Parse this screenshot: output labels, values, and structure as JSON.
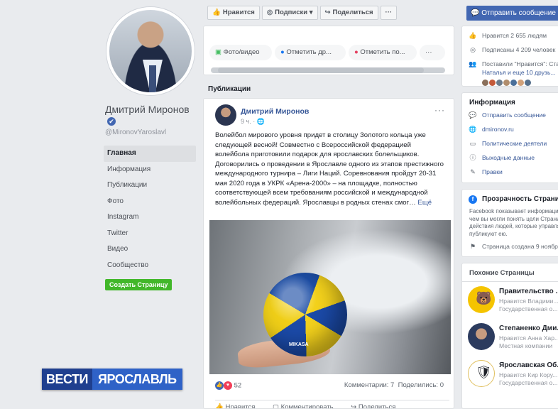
{
  "profile": {
    "name": "Дмитрий Миронов",
    "handle": "@MironovYaroslavl",
    "verified_icon": "✔"
  },
  "nav": {
    "items": [
      "Главная",
      "Информация",
      "Публикации",
      "Фото",
      "Instagram",
      "Twitter",
      "Видео",
      "Сообщество"
    ],
    "create_page": "Создать Страницу"
  },
  "actions": {
    "like": "Нравится",
    "subscribe": "Подписки",
    "share": "Поделиться",
    "more": "···",
    "send_message": "Отправить сообщение"
  },
  "composer": {
    "photo_video": "Фото/видео",
    "tag_friends": "Отметить др...",
    "check_in": "Отметить по...",
    "more": "···"
  },
  "publications": {
    "heading": "Публикации"
  },
  "post": {
    "author": "Дмитрий Миронов",
    "time": "9 ч.",
    "text": "Волейбол мирового уровня придет в столицу Золотого кольца уже следующей весной! Совместно с Всероссийской федерацией волейбола приготовили подарок для ярославских болельщиков. Договорились о проведении в Ярославле одного из этапов престижного международного турнира – Лиги Наций. Соревнования пройдут 20-31 мая 2020 года в УКРК «Арена-2000» – на площадке, полностью соответствующей всем требованиям российской и международной волейбольных федераций. Ярославцы в родных стенах смог…",
    "more": "Ещё",
    "reaction_count": "52",
    "comments": "Комментарии: 7",
    "shares": "Поделились: 0",
    "actions": [
      "Нравится",
      "Комментировать",
      "Поделиться"
    ],
    "photo_ball_brand": "MIKASA"
  },
  "stats": {
    "likes": "Нравится 2 655 людям",
    "follows": "Подписаны 4 209 человек",
    "friends_liked": "Поставили \"Нравится\": Ста...",
    "friends_liked_2": "Наталья и еще 10 друзь..."
  },
  "info": {
    "title": "Информация",
    "rows": [
      "Отправить сообщение",
      "dmironov.ru",
      "Политические деятели",
      "Выходные данные",
      "Правки"
    ]
  },
  "transparency": {
    "title": "Прозрачность Страни...",
    "text_1": "Facebook показывает информацию,",
    "text_2": "чем вы могли понять цели Страницы.",
    "text_3": "действия людей, которые управляют",
    "text_4": "публикуют ею.",
    "created": "Страница создана 9 ноября..."
  },
  "similar": {
    "title": "Похожие Страницы",
    "pages": [
      {
        "name": "Правительство ...",
        "sub_1": "Нравится Владими...",
        "sub_2": "Государственная о..."
      },
      {
        "name": "Степаненко Дми...",
        "sub_1": "Нравится Анна Хар...",
        "sub_2": "Местная компании"
      },
      {
        "name": "Ярославская Об...",
        "sub_1": "Нравится Кир Кору...",
        "sub_2": "Государственная о..."
      }
    ]
  },
  "tv_logo": {
    "part_a": "ВЕСТИ",
    "part_b": "ЯРОСЛАВЛЬ"
  },
  "colors": {
    "brand_blue": "#4267b2",
    "link_blue": "#385898",
    "create_green": "#42b72a"
  }
}
